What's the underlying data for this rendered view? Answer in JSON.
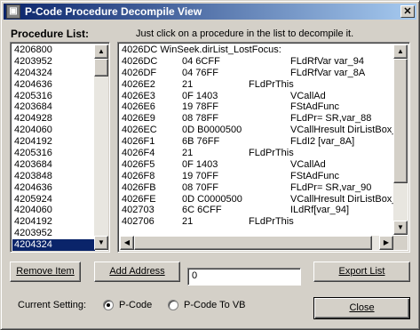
{
  "window": {
    "title": "P-Code Procedure Decompile View",
    "close_glyph": "✕"
  },
  "procedure_list": {
    "label": "Procedure List:",
    "items": [
      "4206800",
      "4203952",
      "4204324",
      "4204636",
      "4205316",
      "4203684",
      "4204928",
      "4204060",
      "4204192",
      "4205316",
      "4203684",
      "4203848",
      "4204636",
      "4205924",
      "4204060",
      "4204192",
      "4203952",
      "4204324"
    ],
    "selected_index": 17
  },
  "instructions": "Just click on a procedure in the list to decompile it.",
  "code_view": {
    "header": "4026DC WinSeek.dirList_LostFocus:",
    "lines": [
      {
        "addr": "4026DC",
        "bytes": "04 6CFF",
        "op": "FLdRfVar var_94"
      },
      {
        "addr": "4026DF",
        "bytes": "04 76FF",
        "op": "FLdRfVar var_8A"
      },
      {
        "addr": "4026E2",
        "bytes": "21",
        "op": "FLdPrThis"
      },
      {
        "addr": "4026E3",
        "bytes": "0F 1403",
        "op": "VCallAd"
      },
      {
        "addr": "4026E6",
        "bytes": "19 78FF",
        "op": "FStAdFunc"
      },
      {
        "addr": "4026E9",
        "bytes": "08 78FF",
        "op": "FLdPr= SR,var_88"
      },
      {
        "addr": "4026EC",
        "bytes": "0D B0000500",
        "op": "VCallHresult DirListBox_I"
      },
      {
        "addr": "4026F1",
        "bytes": "6B 76FF",
        "op": "FLdI2 [var_8A]"
      },
      {
        "addr": "4026F4",
        "bytes": "21",
        "op": "FLdPrThis"
      },
      {
        "addr": "4026F5",
        "bytes": "0F 1403",
        "op": "VCallAd"
      },
      {
        "addr": "4026F8",
        "bytes": "19 70FF",
        "op": "FStAdFunc"
      },
      {
        "addr": "4026FB",
        "bytes": "08 70FF",
        "op": "FLdPr= SR,var_90"
      },
      {
        "addr": "4026FE",
        "bytes": "0D C0000500",
        "op": "VCallHresult DirListBox_I"
      },
      {
        "addr": "402703",
        "bytes": "6C 6CFF",
        "op": "ILdRf[var_94]"
      },
      {
        "addr": "402706",
        "bytes": "21",
        "op": "FLdPrThis"
      }
    ]
  },
  "buttons": {
    "remove_item": "Remove Item",
    "add_address": "Add Address",
    "export_list": "Export List",
    "close": "Close"
  },
  "address_input": {
    "value": "0"
  },
  "setting": {
    "label": "Current Setting:",
    "options": [
      "P-Code",
      "P-Code To VB"
    ],
    "selected": "P-Code"
  },
  "icons": {
    "scroll_up": "▲",
    "scroll_down": "▼",
    "scroll_left": "◀",
    "scroll_right": "▶"
  }
}
